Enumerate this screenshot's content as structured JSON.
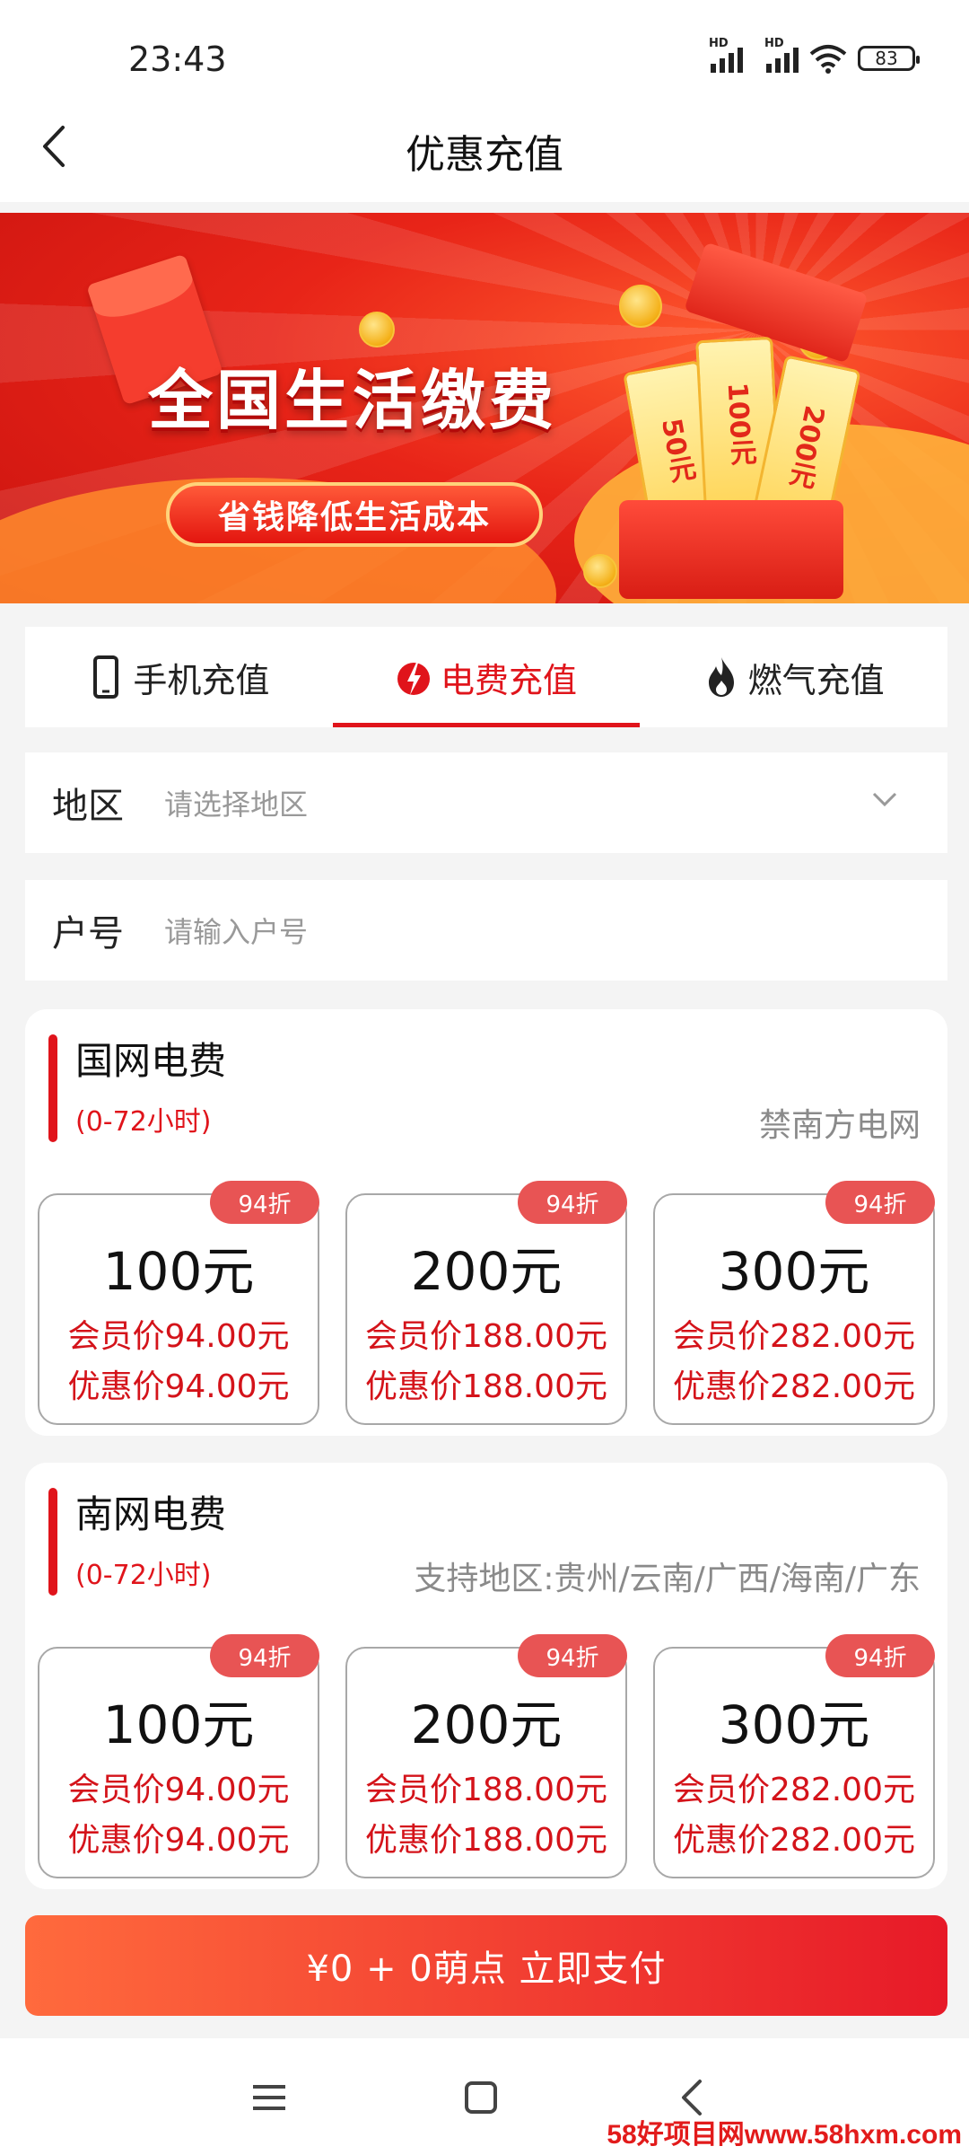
{
  "status_bar": {
    "time": "23:43",
    "signal_badge_1": "HD",
    "signal_badge_2": "HD",
    "battery": "83"
  },
  "header": {
    "title": "优惠充值"
  },
  "banner": {
    "title": "全国生活缴费",
    "subtitle": "省钱降低生活成本",
    "ticket_labels": [
      "50元",
      "100元",
      "200元"
    ]
  },
  "tabs": [
    {
      "label": "手机充值",
      "icon": "phone-icon"
    },
    {
      "label": "电费充值",
      "icon": "lightning-icon",
      "active": true
    },
    {
      "label": "燃气充值",
      "icon": "flame-icon"
    }
  ],
  "form": {
    "region": {
      "label": "地区",
      "placeholder": "请选择地区"
    },
    "account": {
      "label": "户号",
      "placeholder": "请输入户号"
    }
  },
  "cards": [
    {
      "title": "国网电费",
      "hours": "(0-72小时)",
      "right_text": "禁南方电网",
      "options": [
        {
          "badge": "94折",
          "face": "100元",
          "member": "会员价94.00元",
          "discount": "优惠价94.00元"
        },
        {
          "badge": "94折",
          "face": "200元",
          "member": "会员价188.00元",
          "discount": "优惠价188.00元"
        },
        {
          "badge": "94折",
          "face": "300元",
          "member": "会员价282.00元",
          "discount": "优惠价282.00元"
        }
      ]
    },
    {
      "title": "南网电费",
      "hours": "(0-72小时)",
      "right_text": "支持地区:贵州/云南/广西/海南/广东",
      "options": [
        {
          "badge": "94折",
          "face": "100元",
          "member": "会员价94.00元",
          "discount": "优惠价94.00元"
        },
        {
          "badge": "94折",
          "face": "200元",
          "member": "会员价188.00元",
          "discount": "优惠价188.00元"
        },
        {
          "badge": "94折",
          "face": "300元",
          "member": "会员价282.00元",
          "discount": "优惠价282.00元"
        }
      ]
    }
  ],
  "pay_button": {
    "label": "¥0 + 0萌点 立即支付"
  },
  "watermark": "58好项目网www.58hxm.com",
  "colors": {
    "accent": "#e0141b",
    "pay_gradient_start": "#ff6a3d",
    "pay_gradient_end": "#e71a28"
  }
}
